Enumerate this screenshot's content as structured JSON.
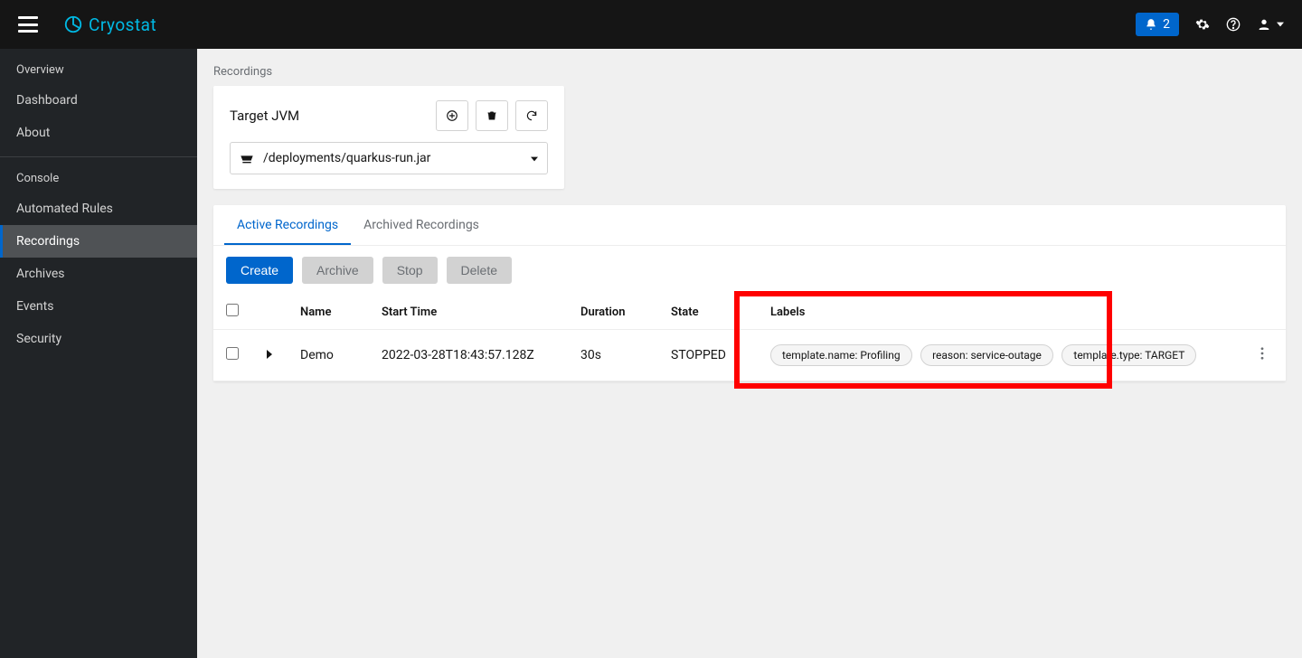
{
  "brand": "Cryostat",
  "notif_count": "2",
  "sidebar": {
    "items": [
      {
        "label": "Overview",
        "section": true
      },
      {
        "label": "Dashboard"
      },
      {
        "label": "About"
      },
      {
        "label": "Console",
        "section": true
      },
      {
        "label": "Automated Rules"
      },
      {
        "label": "Recordings",
        "active": true
      },
      {
        "label": "Archives"
      },
      {
        "label": "Events"
      },
      {
        "label": "Security"
      }
    ]
  },
  "breadcrumb": "Recordings",
  "target": {
    "title": "Target JVM",
    "selected": "/deployments/quarkus-run.jar"
  },
  "tabs": {
    "active": "Active Recordings",
    "archived": "Archived Recordings"
  },
  "toolbar": {
    "create": "Create",
    "archive": "Archive",
    "stop": "Stop",
    "delete": "Delete"
  },
  "columns": {
    "name": "Name",
    "start": "Start Time",
    "duration": "Duration",
    "state": "State",
    "labels": "Labels"
  },
  "rows": [
    {
      "name": "Demo",
      "start": "2022-03-28T18:43:57.128Z",
      "duration": "30s",
      "state": "STOPPED",
      "labels": [
        "template.name: Profiling",
        "reason: service-outage",
        "template.type: TARGET"
      ]
    }
  ]
}
